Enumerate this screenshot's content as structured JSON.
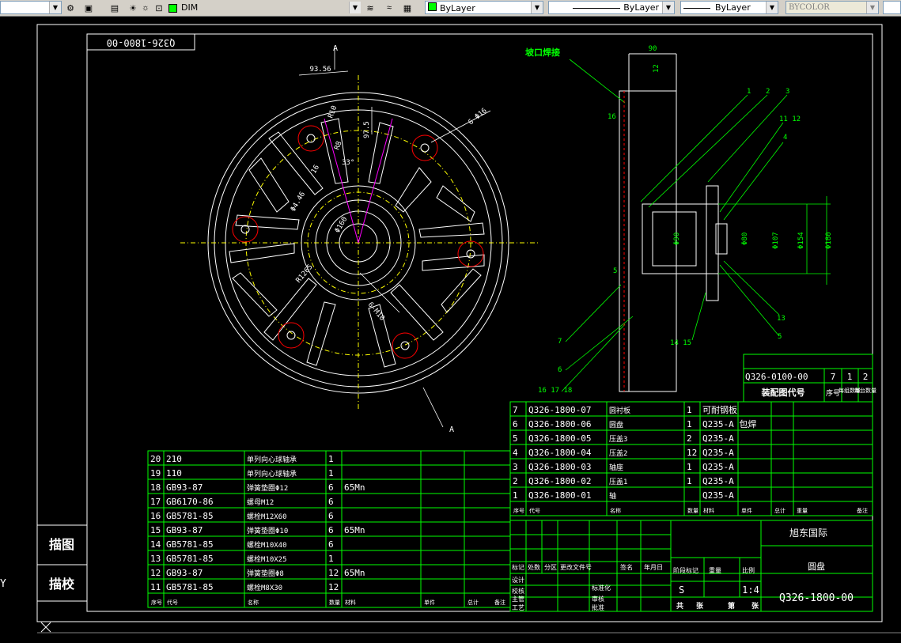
{
  "toolbar": {
    "dimstyle": "DIM",
    "color": "ByLayer",
    "linetype": "ByLayer",
    "lineweight": "ByLayer",
    "plotstyle": "BYCOLOR",
    "colors": {
      "layer_swatch": "#00ff00",
      "color_swatch": "#00ff00"
    }
  },
  "drawing": {
    "title_box": "Q326-1800-00",
    "view_marker": "A",
    "main_view": {
      "dim_936": "93.56",
      "dim_r10": "R10",
      "dim_975": "97.5",
      "dim_6phi16": "6-Φ16",
      "dim_r8": "R8",
      "dim_33": "33°",
      "dim_446": "Φ4.46",
      "dim_16": "16",
      "dim_160": "Φ160",
      "dim_r1265": "R1265",
      "dim_6m10": "6-M10"
    },
    "side_view": {
      "welding": "坡口焊接",
      "dim_90": "90",
      "dim_12": "12",
      "dim_16": "16",
      "labels": [
        "1",
        "2",
        "3",
        "11 12",
        "4",
        "13",
        "5",
        "14 15",
        "7",
        "6",
        "16 17 18",
        "5"
      ],
      "dims_v": [
        "Φ90",
        "Φ80",
        "Φ107",
        "Φ154",
        "Φ180"
      ]
    },
    "assembly_ref": {
      "code": "Q326-0100-00",
      "label": "装配图代号",
      "col1": "7",
      "col2": "1",
      "col3": "2",
      "h1": "序号",
      "h2": "每组数量",
      "h3": "每台数量"
    },
    "parts_right": [
      {
        "no": "7",
        "code": "Q326-1800-07",
        "name": "圆衬板",
        "qty": "1",
        "mat": "可耐钢板"
      },
      {
        "no": "6",
        "code": "Q326-1800-06",
        "name": "圆盘",
        "qty": "1",
        "mat": "Q235-A 包焊"
      },
      {
        "no": "5",
        "code": "Q326-1800-05",
        "name": "压盖3",
        "qty": "2",
        "mat": "Q235-A"
      },
      {
        "no": "4",
        "code": "Q326-1800-04",
        "name": "压盖2",
        "qty": "12",
        "mat": "Q235-A"
      },
      {
        "no": "3",
        "code": "Q326-1800-03",
        "name": "轴座",
        "qty": "1",
        "mat": "Q235-A"
      },
      {
        "no": "2",
        "code": "Q326-1800-02",
        "name": "压盖1",
        "qty": "1",
        "mat": "Q235-A"
      },
      {
        "no": "1",
        "code": "Q326-1800-01",
        "name": "轴",
        "qty": "",
        "mat": "Q235-A"
      }
    ],
    "parts_right_header": [
      "序号",
      "代号",
      "名称",
      "数量",
      "材料",
      "单件",
      "总计",
      "重量",
      "备注"
    ],
    "parts_left": [
      {
        "no": "20",
        "code": "210",
        "name": "单列向心球轴承",
        "qty": "1",
        "mat": ""
      },
      {
        "no": "19",
        "code": "110",
        "name": "单列向心球轴承",
        "qty": "1",
        "mat": ""
      },
      {
        "no": "18",
        "code": "GB93-87",
        "name": "弹簧垫圈Φ12",
        "qty": "6",
        "mat": "65Mn"
      },
      {
        "no": "17",
        "code": "GB6170-86",
        "name": "螺母M12",
        "qty": "6",
        "mat": ""
      },
      {
        "no": "16",
        "code": "GB5781-85",
        "name": "螺栓M12X60",
        "qty": "6",
        "mat": ""
      },
      {
        "no": "15",
        "code": "GB93-87",
        "name": "弹簧垫圈Φ10",
        "qty": "6",
        "mat": "65Mn"
      },
      {
        "no": "14",
        "code": "GB5781-85",
        "name": "螺栓M10X40",
        "qty": "6",
        "mat": ""
      },
      {
        "no": "13",
        "code": "GB5781-85",
        "name": "螺栓M10X25",
        "qty": "1",
        "mat": ""
      },
      {
        "no": "12",
        "code": "GB93-87",
        "name": "弹簧垫圈Φ8",
        "qty": "12",
        "mat": "65Mn"
      },
      {
        "no": "11",
        "code": "GB5781-85",
        "name": "螺栓M8X30",
        "qty": "12",
        "mat": ""
      }
    ],
    "parts_left_header": [
      "序号",
      "代号",
      "名称",
      "数量",
      "材料",
      "单件",
      "总计",
      "备注"
    ],
    "title_block": {
      "company": "旭东国际",
      "part_name": "圆盘",
      "drawing_no": "Q326-1800-00",
      "scale": "1:4",
      "stage": "S",
      "sheet_total": "共",
      "sheet_label": "张",
      "sheet_no": "第",
      "sheet_label2": "张",
      "revision_header": [
        "标记",
        "处数",
        "分区",
        "更改文件号",
        "签名",
        "年月日"
      ],
      "rows": [
        "设计",
        "校核",
        "主管",
        "工艺"
      ],
      "approvals": [
        "标准化",
        "审核",
        "批准"
      ],
      "stage_header": [
        "阶段标记",
        "重量",
        "比例"
      ]
    },
    "left_stamps": [
      "描图",
      "描校"
    ]
  }
}
